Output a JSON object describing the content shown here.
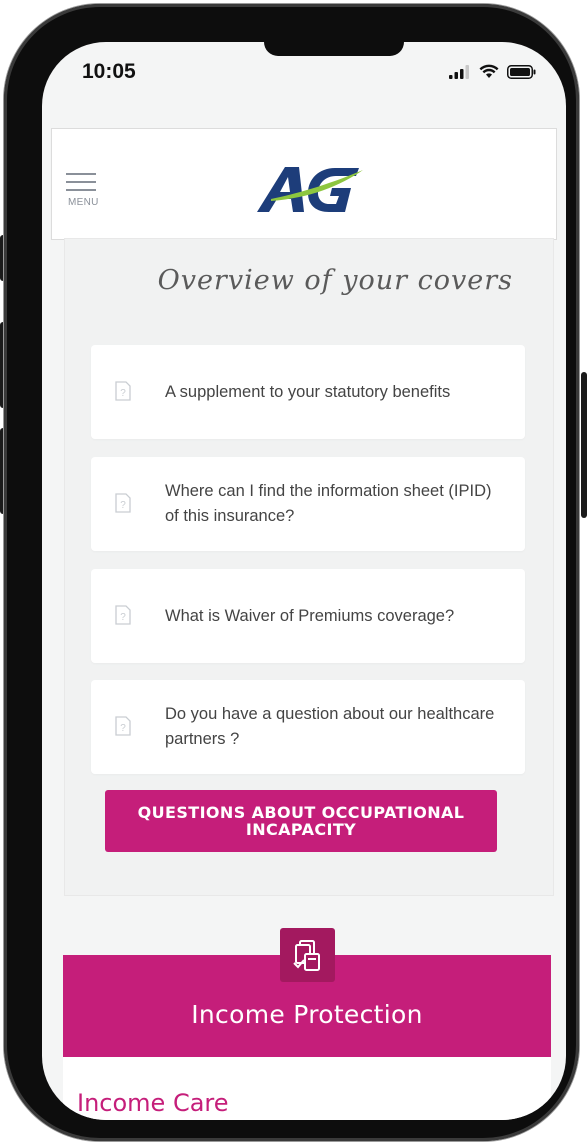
{
  "status_bar": {
    "time": "10:05"
  },
  "header": {
    "menu_label": "MENU",
    "logo_text": "AG"
  },
  "overview": {
    "title": "Overview of your covers",
    "items": [
      {
        "label": "A supplement to your statutory benefits",
        "icon": "help-document-icon"
      },
      {
        "label": "Where can I find the information sheet (IPID) of this insurance?",
        "icon": "help-document-icon"
      },
      {
        "label": "What is Waiver of Premiums coverage?",
        "icon": "help-document-icon"
      },
      {
        "label": "Do you have a question about our healthcare partners ?",
        "icon": "help-document-icon"
      }
    ],
    "cta_label": "QUESTIONS ABOUT OCCUPATIONAL INCAPACITY"
  },
  "income": {
    "icon": "documents-check-icon",
    "title": "Income Protection",
    "sub_label": "Income Care"
  },
  "colors": {
    "accent": "#c51e7a",
    "accent_dark": "#a3195f",
    "logo_blue": "#1d3d7a",
    "logo_green": "#8dc63f"
  }
}
